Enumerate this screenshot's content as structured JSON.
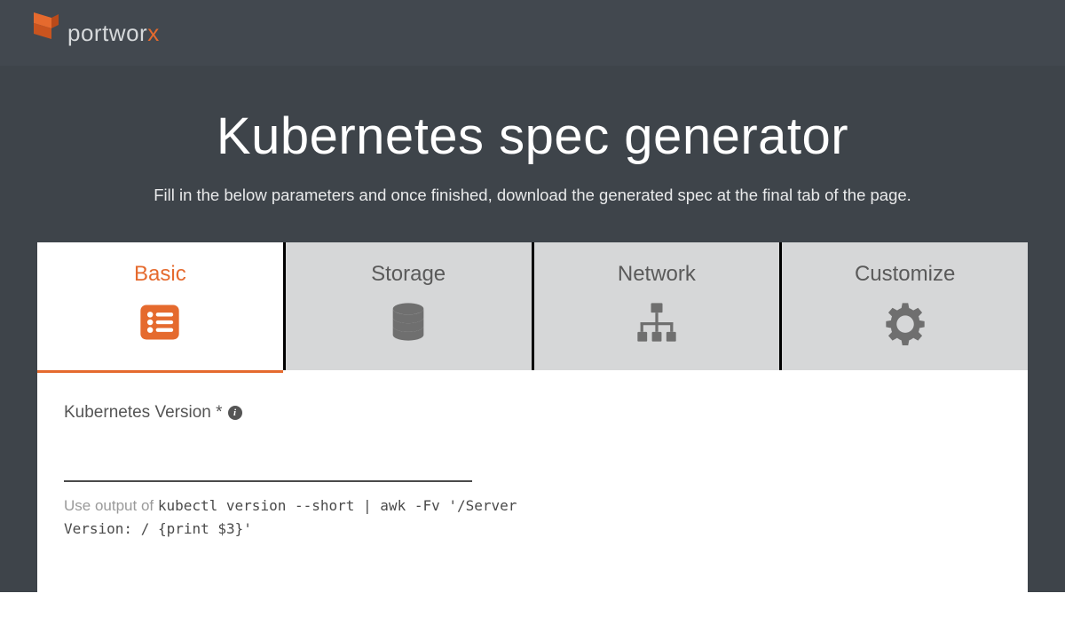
{
  "brand": {
    "name_prefix": "portwor",
    "name_suffix": "x"
  },
  "hero": {
    "title": "Kubernetes spec generator",
    "subtitle": "Fill in the below parameters and once finished, download the generated spec at the final tab of the page."
  },
  "tabs": [
    {
      "label": "Basic",
      "active": true
    },
    {
      "label": "Storage",
      "active": false
    },
    {
      "label": "Network",
      "active": false
    },
    {
      "label": "Customize",
      "active": false
    }
  ],
  "form": {
    "k8s_version": {
      "label": "Kubernetes Version *",
      "value": "",
      "hint_prefix": "Use output of ",
      "hint_code": "kubectl version --short | awk -Fv '/Server Version: / {print $3}'"
    }
  }
}
